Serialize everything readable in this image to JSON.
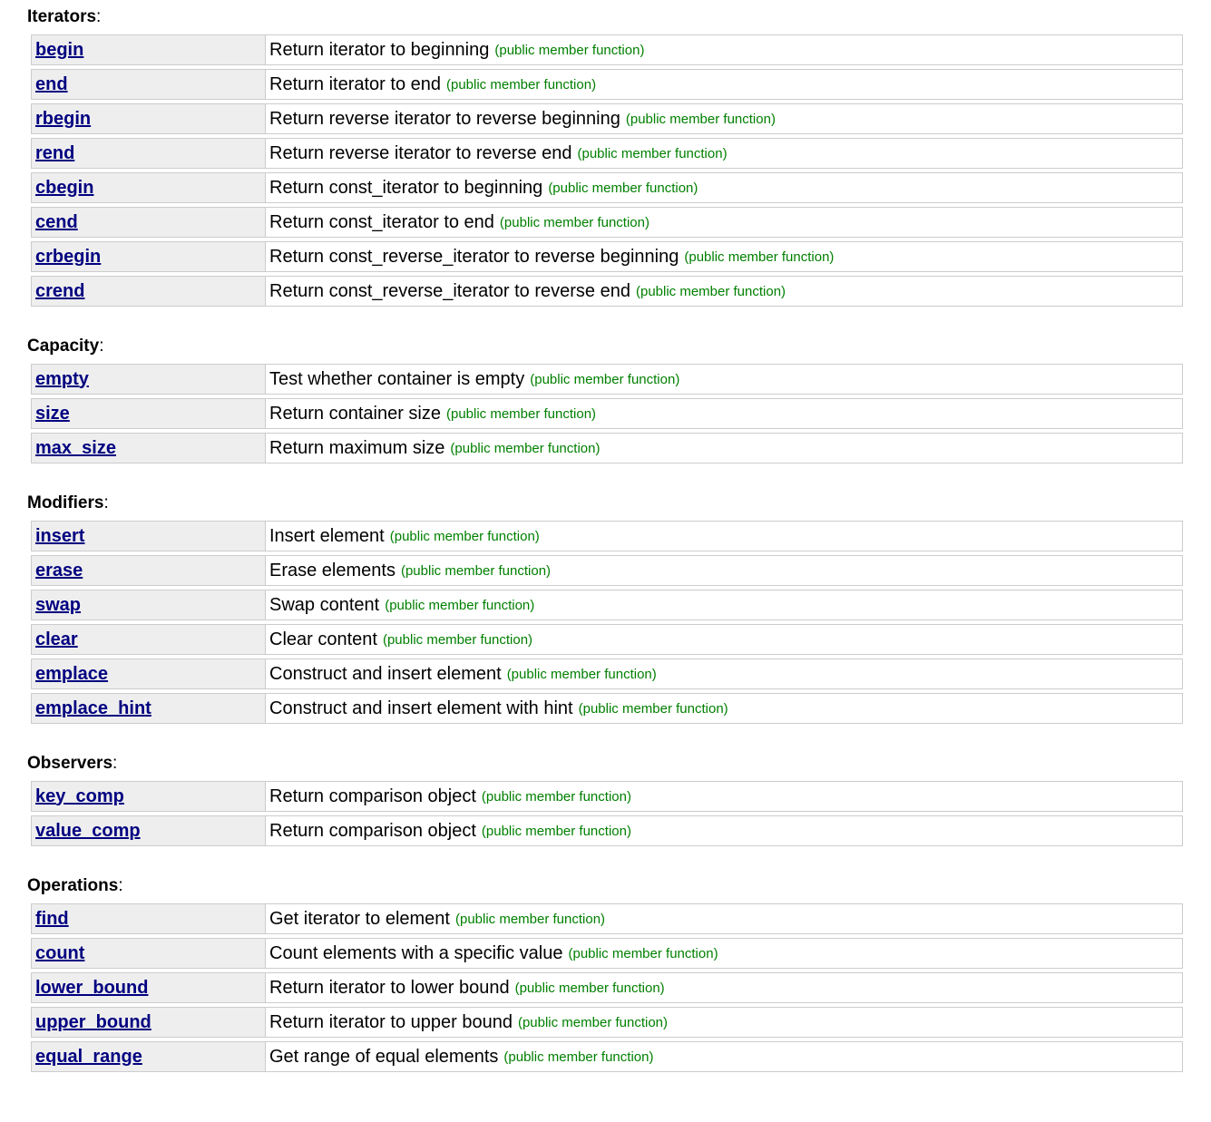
{
  "sections": [
    {
      "title": "Iterators",
      "members": [
        {
          "name": "begin",
          "desc": "Return iterator to beginning",
          "kind": "(public member function)"
        },
        {
          "name": "end",
          "desc": "Return iterator to end",
          "kind": "(public member function)"
        },
        {
          "name": "rbegin",
          "desc": "Return reverse iterator to reverse beginning",
          "kind": "(public member function)"
        },
        {
          "name": "rend",
          "desc": "Return reverse iterator to reverse end",
          "kind": "(public member function)"
        },
        {
          "name": "cbegin",
          "desc": "Return const_iterator to beginning",
          "kind": "(public member function)"
        },
        {
          "name": "cend",
          "desc": "Return const_iterator to end",
          "kind": "(public member function)"
        },
        {
          "name": "crbegin",
          "desc": "Return const_reverse_iterator to reverse beginning",
          "kind": "(public member function)"
        },
        {
          "name": "crend",
          "desc": "Return const_reverse_iterator to reverse end",
          "kind": "(public member function)"
        }
      ]
    },
    {
      "title": "Capacity",
      "members": [
        {
          "name": "empty",
          "desc": "Test whether container is empty",
          "kind": "(public member function)"
        },
        {
          "name": "size",
          "desc": "Return container size",
          "kind": "(public member function)"
        },
        {
          "name": "max_size",
          "desc": "Return maximum size",
          "kind": "(public member function)"
        }
      ]
    },
    {
      "title": "Modifiers",
      "members": [
        {
          "name": "insert",
          "desc": "Insert element",
          "kind": "(public member function)"
        },
        {
          "name": "erase",
          "desc": "Erase elements",
          "kind": "(public member function)"
        },
        {
          "name": "swap",
          "desc": "Swap content",
          "kind": "(public member function)"
        },
        {
          "name": "clear",
          "desc": "Clear content",
          "kind": "(public member function)"
        },
        {
          "name": "emplace",
          "desc": "Construct and insert element",
          "kind": "(public member function)"
        },
        {
          "name": "emplace_hint",
          "desc": "Construct and insert element with hint",
          "kind": "(public member function)"
        }
      ]
    },
    {
      "title": "Observers",
      "members": [
        {
          "name": "key_comp",
          "desc": "Return comparison object",
          "kind": "(public member function)"
        },
        {
          "name": "value_comp",
          "desc": "Return comparison object",
          "kind": "(public member function)"
        }
      ]
    },
    {
      "title": "Operations",
      "members": [
        {
          "name": "find",
          "desc": "Get iterator to element",
          "kind": "(public member function)"
        },
        {
          "name": "count",
          "desc": "Count elements with a specific value",
          "kind": "(public member function)"
        },
        {
          "name": "lower_bound",
          "desc": "Return iterator to lower bound",
          "kind": "(public member function)"
        },
        {
          "name": "upper_bound",
          "desc": "Return iterator to upper bound",
          "kind": "(public member function)"
        },
        {
          "name": "equal_range",
          "desc": "Get range of equal elements",
          "kind": "(public member function)"
        }
      ]
    }
  ],
  "heading_suffix": ":",
  "colors": {
    "link": "#000080",
    "kind": "#008000",
    "name_cell_bg": "#eeeeee",
    "border": "#cccccc"
  }
}
